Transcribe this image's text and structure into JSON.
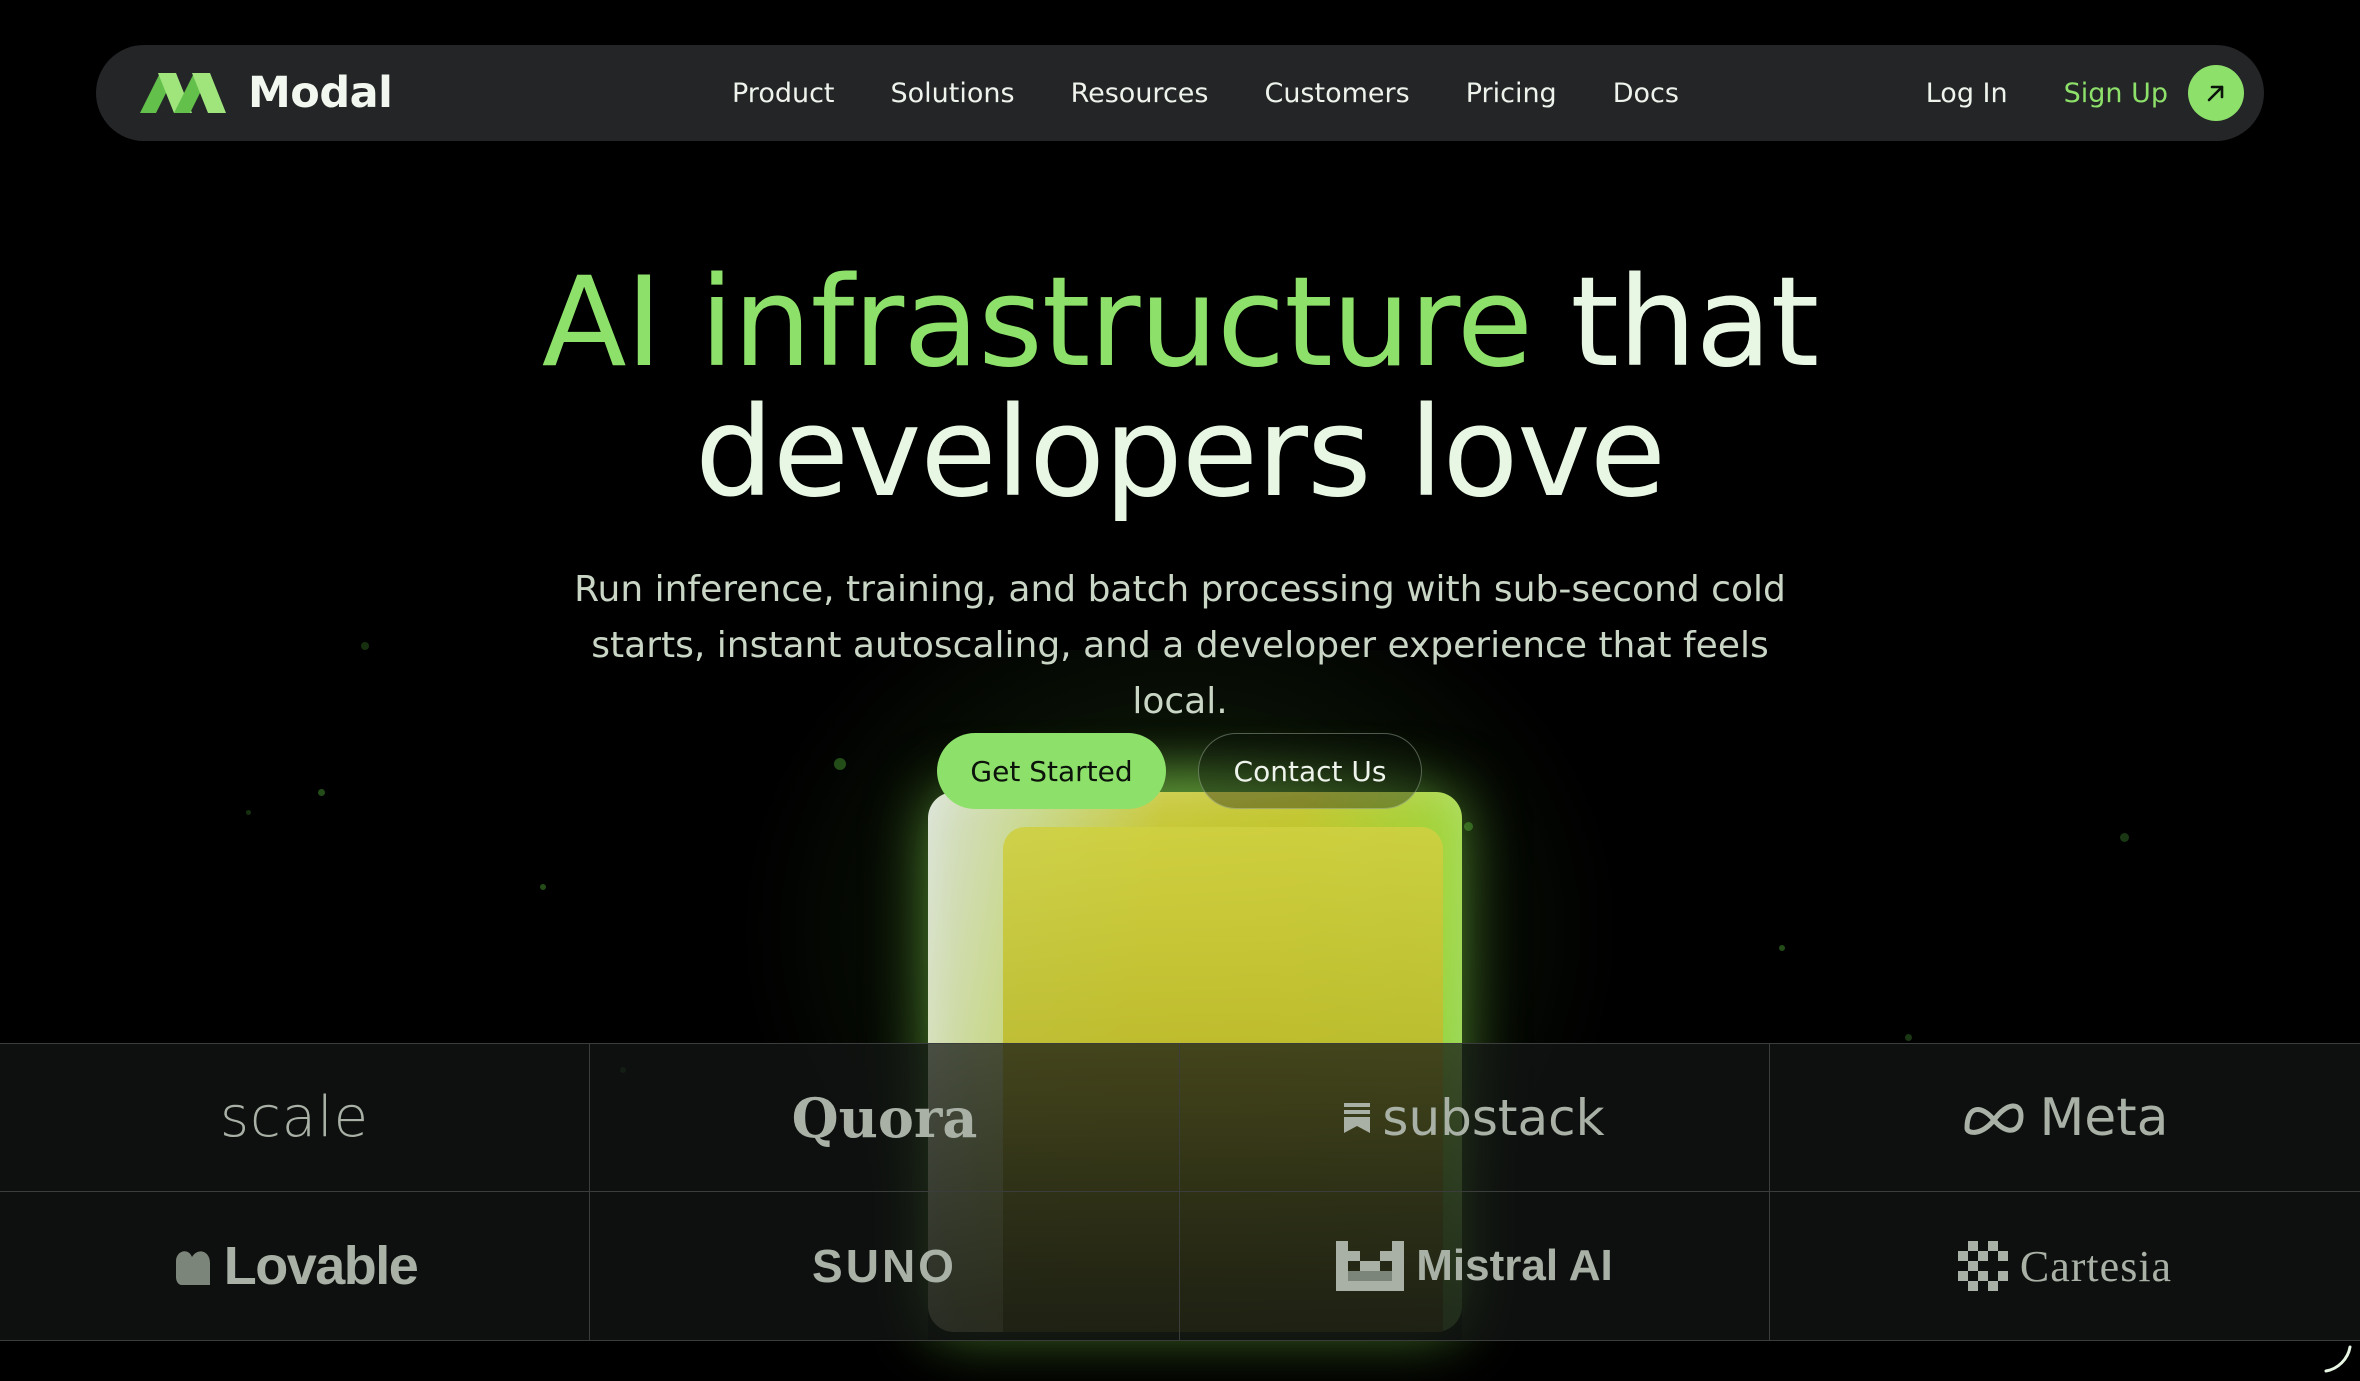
{
  "nav": {
    "brand": "Modal",
    "links": [
      "Product",
      "Solutions",
      "Resources",
      "Customers",
      "Pricing",
      "Docs"
    ],
    "login": "Log In",
    "signup": "Sign Up"
  },
  "hero": {
    "title_accent": "AI infrastructure",
    "title_rest_line1": " that",
    "title_line2": "developers love",
    "subtitle": "Run inference, training, and batch processing with sub-second cold starts, instant autoscaling, and a developer experience that feels local."
  },
  "cta": {
    "primary": "Get Started",
    "secondary": "Contact Us"
  },
  "customers": [
    {
      "name": "scale"
    },
    {
      "name": "Quora"
    },
    {
      "name": "substack"
    },
    {
      "name": "Meta"
    },
    {
      "name": "Lovable"
    },
    {
      "name": "SUNO"
    },
    {
      "name": "Mistral AI"
    },
    {
      "name": "Cartesia"
    }
  ],
  "colors": {
    "accent": "#8de06a",
    "nav_bg": "#232527",
    "background": "#000000",
    "text_light": "#e8f7e4"
  }
}
